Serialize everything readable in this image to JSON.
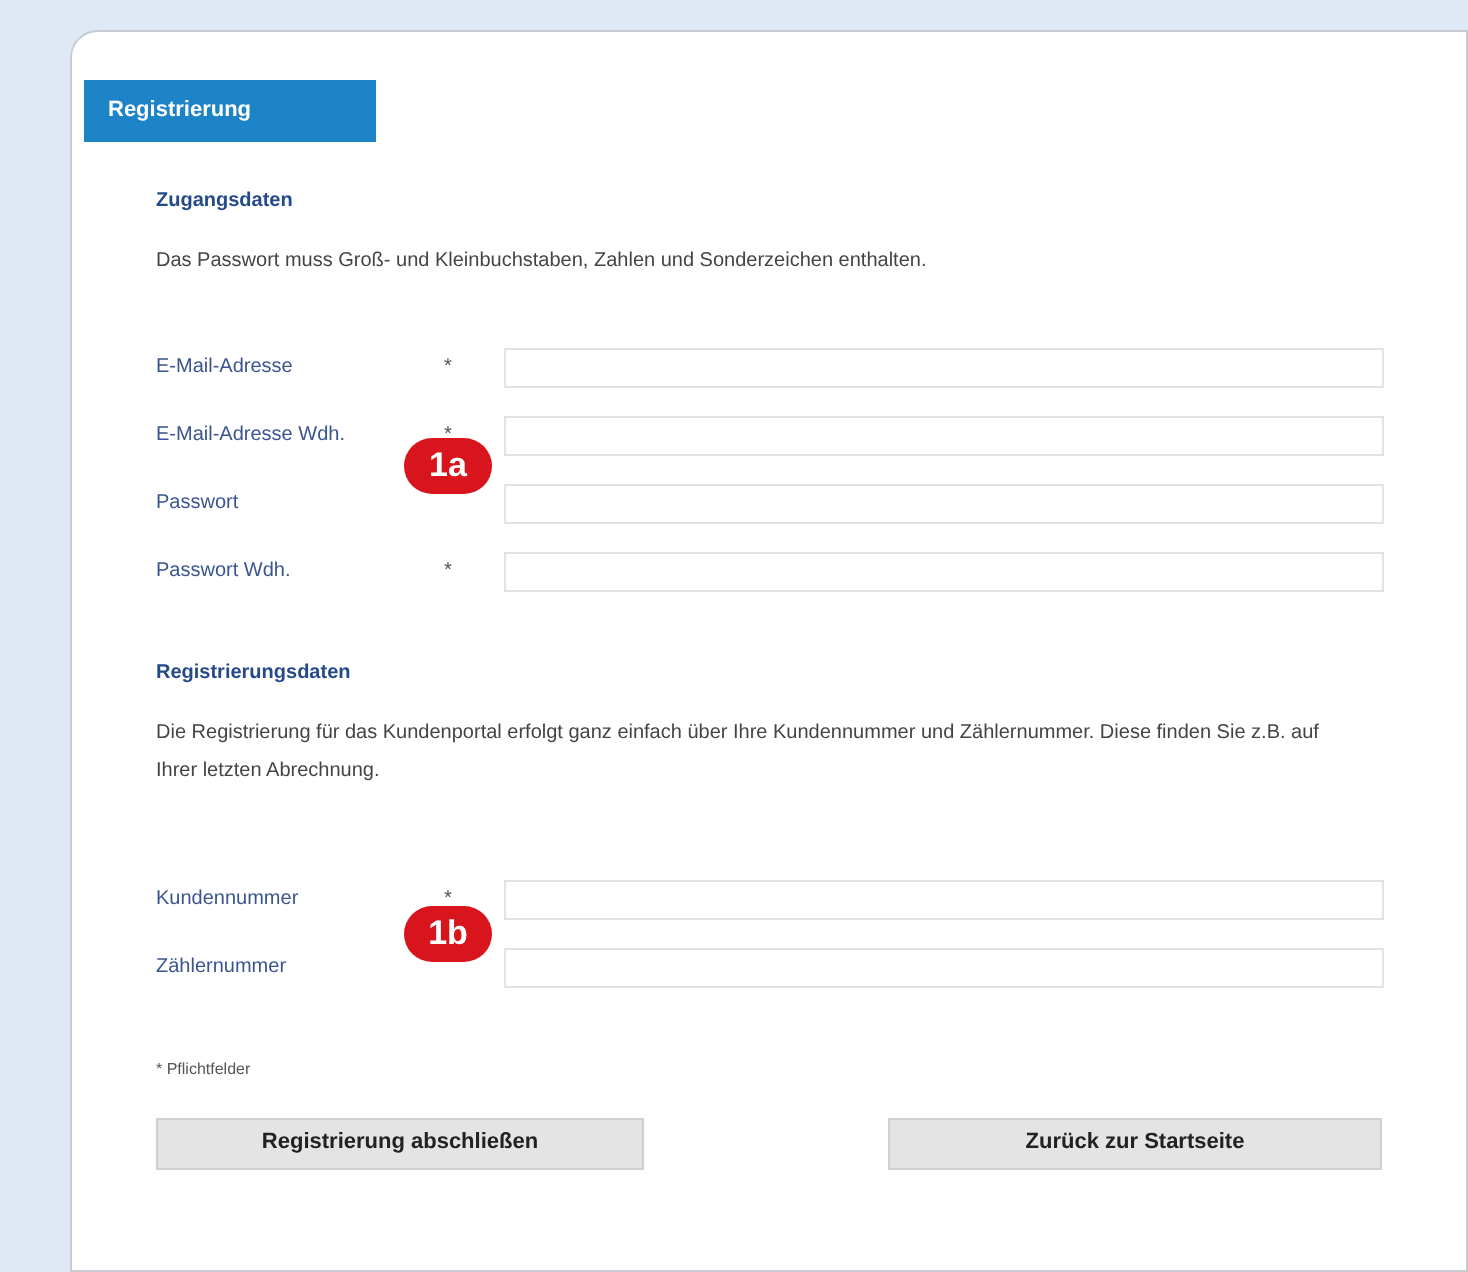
{
  "tab": {
    "label": "Registrierung",
    "selected": true
  },
  "sections": [
    {
      "heading": "Zugangsdaten",
      "text": "Das Passwort muss Groß- und Kleinbuchstaben, Zahlen und Sonderzeichen enthalten.",
      "fields": [
        {
          "label": "E-Mail-Adresse",
          "asterisk": "*"
        },
        {
          "label": "E-Mail-Adresse Wdh.",
          "asterisk": "*"
        },
        {
          "label": "Passwort"
        },
        {
          "label": "Passwort Wdh.",
          "asterisk": "*"
        }
      ],
      "marker": "1a"
    },
    {
      "heading": "Registrierungsdaten",
      "text": "Die Registrierung für das Kundenportal erfolgt ganz einfach über Ihre Kundennummer und Zählernummer. Diese finden Sie z.B. auf Ihrer letzten Abrechnung.",
      "fields": [
        {
          "label": "Kundennummer",
          "asterisk": "*"
        },
        {
          "label": "Zählernummer"
        }
      ],
      "marker": "1b"
    }
  ],
  "footnote": "* Pflichtfelder",
  "buttons": [
    "Registrierung abschließen",
    "Zurück zur Startseite"
  ]
}
